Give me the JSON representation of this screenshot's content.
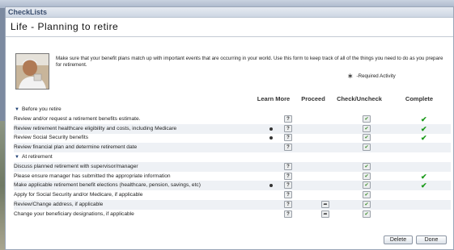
{
  "window": {
    "title": "CheckLists"
  },
  "page": {
    "title": "Life - Planning to retire",
    "intro": "Make sure that your benefit plans match up with important events that are occurring in your world. Use this form to keep track of all of the things you need to do as you prepare for retirement.",
    "required_symbol": "∗",
    "required_note": "-Required Activity"
  },
  "columns": {
    "learn_more": "Learn More",
    "proceed": "Proceed",
    "check": "Check/Uncheck",
    "complete": "Complete"
  },
  "sections": [
    {
      "title": "Before you retire",
      "items": [
        {
          "label": "Review and/or request a retirement benefits estimate.",
          "required": false,
          "proceed": false,
          "checked": true,
          "complete": true
        },
        {
          "label": "Review retirement healthcare eligibility and costs, including Medicare",
          "required": true,
          "proceed": false,
          "checked": true,
          "complete": true
        },
        {
          "label": "Review Social Security benefits",
          "required": true,
          "proceed": false,
          "checked": true,
          "complete": true
        },
        {
          "label": "Review financial plan and determine retirement date",
          "required": false,
          "proceed": false,
          "checked": true,
          "complete": false
        }
      ]
    },
    {
      "title": "At retirement",
      "items": [
        {
          "label": "Discuss planned retirement with supervisor/manager",
          "required": false,
          "proceed": false,
          "checked": true,
          "complete": false
        },
        {
          "label": "Please ensure manager has submitted the appropriate information",
          "required": false,
          "proceed": false,
          "checked": true,
          "complete": true
        },
        {
          "label": "Make applicable retirement benefit elections (healthcare, pension, savings, etc)",
          "required": true,
          "proceed": false,
          "checked": true,
          "complete": true
        },
        {
          "label": "Apply for Social Security and/or Medicare, if applicable",
          "required": false,
          "proceed": false,
          "checked": true,
          "complete": false
        },
        {
          "label": "Review/Change address, if applicable",
          "required": false,
          "proceed": true,
          "checked": true,
          "complete": false
        },
        {
          "label": "Change your beneficiary designations, if applicable",
          "required": false,
          "proceed": true,
          "checked": true,
          "complete": false
        }
      ]
    }
  ],
  "icons": {
    "learn_more": "?",
    "proceed": "➦",
    "check": "✔",
    "complete": "✔",
    "section_toggle": "▼"
  },
  "colors": {
    "complete_green": "#1a9a1a",
    "accent": "#1d3f73"
  },
  "buttons": {
    "delete": "Delete",
    "done": "Done"
  }
}
